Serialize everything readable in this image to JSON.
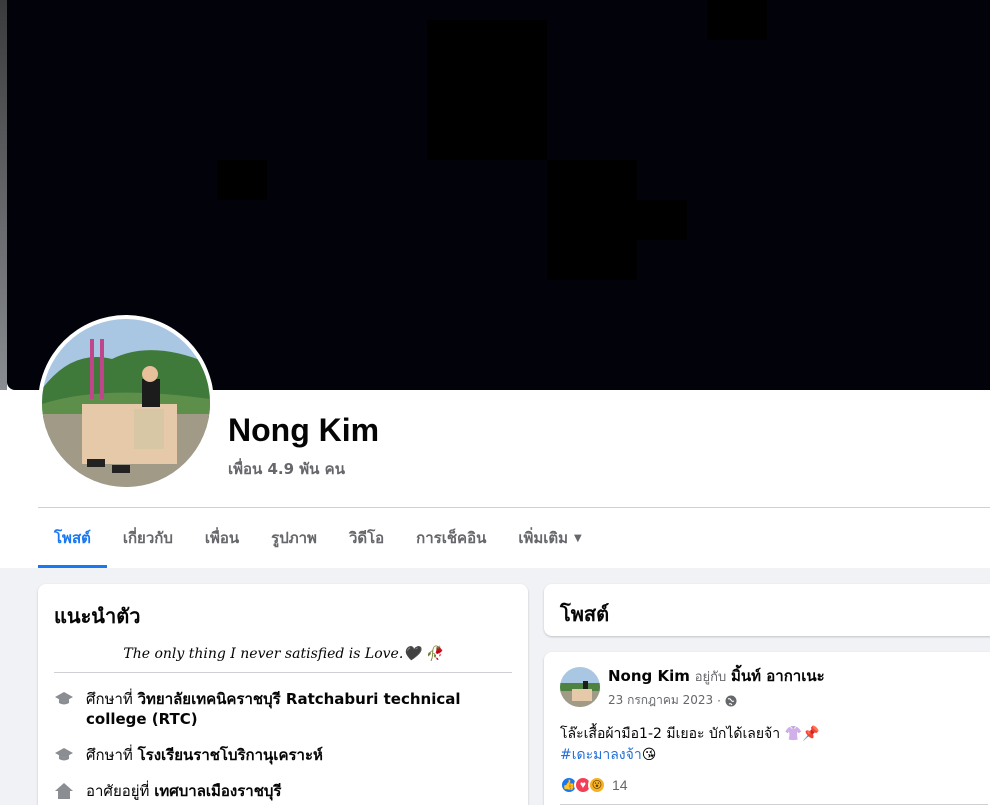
{
  "profile": {
    "name": "Nong Kim",
    "friends": "เพื่อน 4.9 พัน คน"
  },
  "tabs": [
    {
      "label": "โพสต์",
      "active": true
    },
    {
      "label": "เกี่ยวกับ"
    },
    {
      "label": "เพื่อน"
    },
    {
      "label": "รูปภาพ"
    },
    {
      "label": "วิดีโอ"
    },
    {
      "label": "การเช็คอิน"
    },
    {
      "label": "เพิ่มเติม"
    }
  ],
  "intro": {
    "title": "แนะนำตัว",
    "bio": "The only thing I never satisfied is Love.🖤 🥀",
    "items": [
      {
        "icon": "graduation-cap-icon",
        "prefix": "ศึกษาที่",
        "value": "วิทยาลัยเทคนิคราชบุรี Ratchaburi technical college (RTC)"
      },
      {
        "icon": "graduation-cap-icon",
        "prefix": "ศึกษาที่",
        "value": "โรงเรียนราชโบริกานุเคราะห์"
      },
      {
        "icon": "home-icon",
        "prefix": "อาศัยอยู่ที่",
        "value": "เทศบาลเมืองราชบุรี"
      }
    ]
  },
  "posts": {
    "title": "โพสต์",
    "post": {
      "author": "Nong Kim",
      "with_label": "อยู่กับ",
      "tagged": "มิ้นท์ อากาเนะ",
      "date": "23 กรกฎาคม 2023",
      "privacy_icon": "globe-icon",
      "text_line1": "โล๊ะเสื้อผ้ามือ1-2 มีเยอะ บักได้เลยจ้า 👚📌",
      "hashtag": "#เดะมาลงจ้า",
      "hashtag_emoji": "😘",
      "reaction_count": "14"
    }
  },
  "colors": {
    "accent": "#1877f2",
    "cover": "#02030a",
    "background": "#f0f2f5"
  }
}
